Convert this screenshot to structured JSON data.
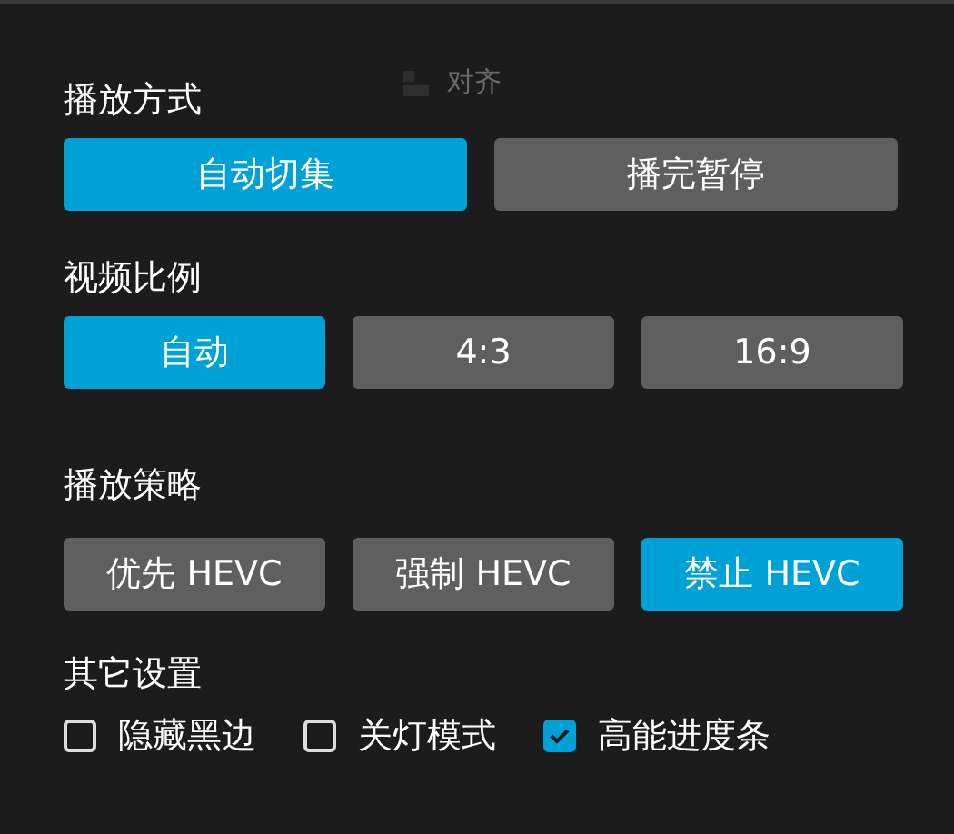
{
  "background_menu": [
    {
      "label": "对齐"
    }
  ],
  "sections": [
    {
      "title": "播放方式",
      "kind": "buttons",
      "options": [
        {
          "label": "自动切集",
          "selected": true
        },
        {
          "label": "播完暂停",
          "selected": false
        }
      ]
    },
    {
      "title": "视频比例",
      "kind": "buttons",
      "options": [
        {
          "label": "自动",
          "selected": true
        },
        {
          "label": "4:3",
          "selected": false
        },
        {
          "label": "16:9",
          "selected": false
        }
      ]
    },
    {
      "title": "播放策略",
      "kind": "buttons",
      "options": [
        {
          "label": "优先 HEVC",
          "selected": false
        },
        {
          "label": "强制 HEVC",
          "selected": false
        },
        {
          "label": "禁止 HEVC",
          "selected": true
        }
      ]
    },
    {
      "title": "其它设置",
      "kind": "checkboxes",
      "options": [
        {
          "label": "隐藏黑边",
          "checked": false
        },
        {
          "label": "关灯模式",
          "checked": false
        },
        {
          "label": "高能进度条",
          "checked": true
        }
      ]
    }
  ]
}
